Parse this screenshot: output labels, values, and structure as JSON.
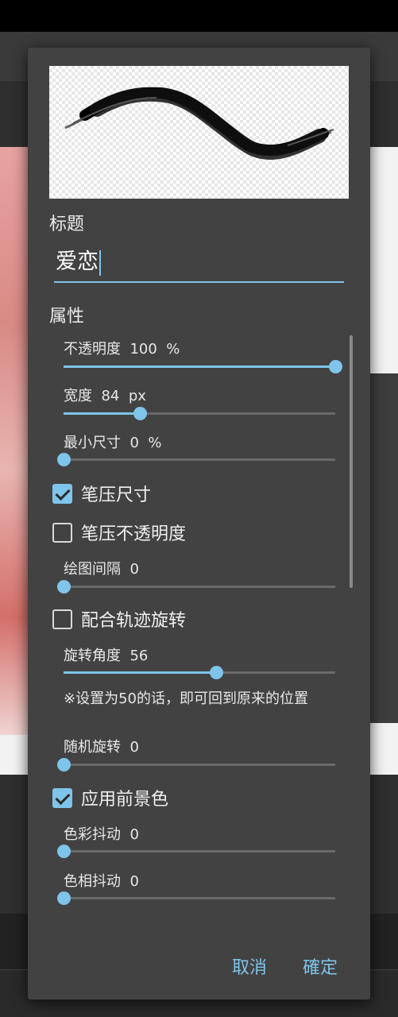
{
  "dialog": {
    "title_section": "标题",
    "title_value": "爱恋",
    "properties_section": "属性",
    "sliders": [
      {
        "label": "不透明度",
        "value": "100",
        "unit": "%",
        "fraction": 1.0
      },
      {
        "label": "宽度",
        "value": "84",
        "unit": "px",
        "fraction": 0.28
      },
      {
        "label": "最小尺寸",
        "value": "0",
        "unit": "%",
        "fraction": 0.0
      },
      {
        "label": "绘图间隔",
        "value": "0",
        "unit": "",
        "fraction": 0.0
      },
      {
        "label": "旋转角度",
        "value": "56",
        "unit": "",
        "fraction": 0.56
      },
      {
        "label": "随机旋转",
        "value": "0",
        "unit": "",
        "fraction": 0.0
      },
      {
        "label": "色彩抖动",
        "value": "0",
        "unit": "",
        "fraction": 0.0
      },
      {
        "label": "色相抖动",
        "value": "0",
        "unit": "",
        "fraction": 0.0
      }
    ],
    "checkboxes": [
      {
        "label": "笔压尺寸",
        "checked": true
      },
      {
        "label": "笔压不透明度",
        "checked": false
      },
      {
        "label": "配合轨迹旋转",
        "checked": false
      },
      {
        "label": "应用前景色",
        "checked": true
      }
    ],
    "rotation_note": "※设置为50的话，即可回到原来的位置",
    "cancel_label": "取消",
    "ok_label": "確定"
  },
  "colors": {
    "accent": "#7fc4ea",
    "dialog_bg": "#424242"
  }
}
